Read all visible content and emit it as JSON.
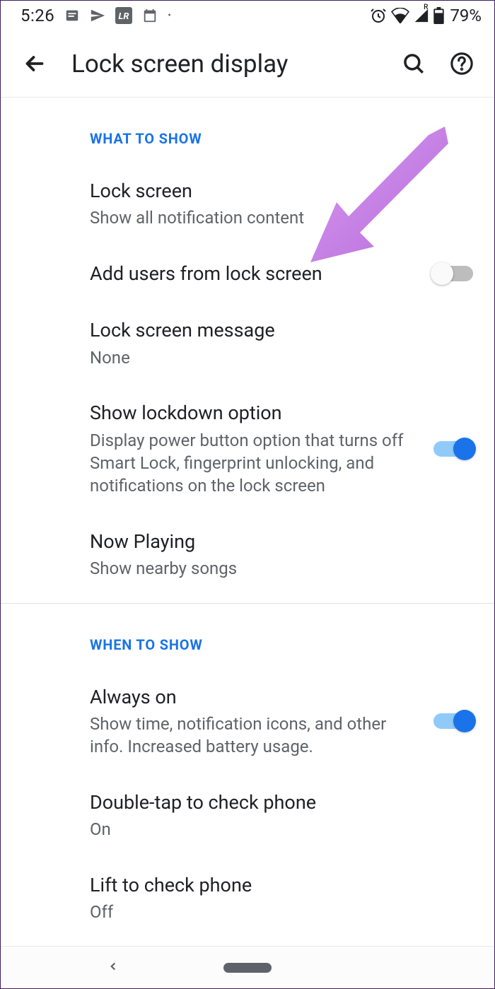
{
  "status_bar": {
    "time": "5:26",
    "battery": "79%"
  },
  "app_bar": {
    "title": "Lock screen display"
  },
  "sections": {
    "what_to_show": {
      "header": "WHAT TO SHOW",
      "items": {
        "lock_screen": {
          "title": "Lock screen",
          "subtitle": "Show all notification content"
        },
        "add_users": {
          "title": "Add users from lock screen"
        },
        "lock_message": {
          "title": "Lock screen message",
          "subtitle": "None"
        },
        "lockdown": {
          "title": "Show lockdown option",
          "subtitle": "Display power button option that turns off Smart Lock, fingerprint unlocking, and notifications on the lock screen"
        },
        "now_playing": {
          "title": "Now Playing",
          "subtitle": "Show nearby songs"
        }
      }
    },
    "when_to_show": {
      "header": "WHEN TO SHOW",
      "items": {
        "always_on": {
          "title": "Always on",
          "subtitle": "Show time, notification icons, and other info. Increased battery usage."
        },
        "double_tap": {
          "title": "Double-tap to check phone",
          "subtitle": "On"
        },
        "lift_check": {
          "title": "Lift to check phone",
          "subtitle": "Off"
        }
      }
    }
  }
}
